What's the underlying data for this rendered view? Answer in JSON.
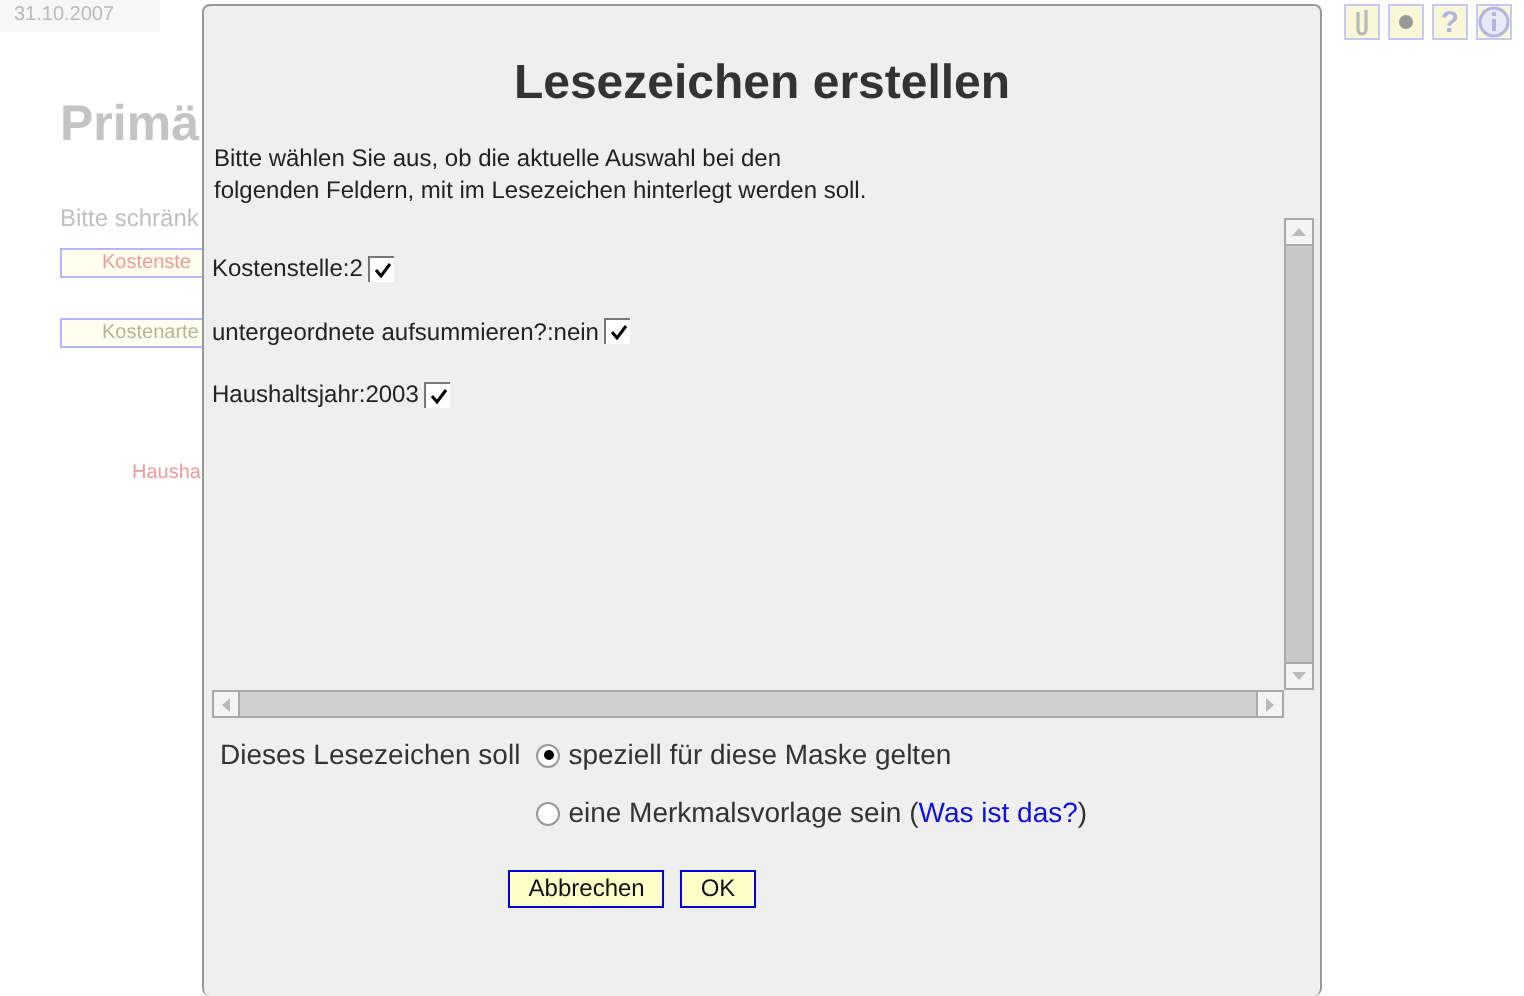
{
  "background": {
    "date": "31.10.2007",
    "title": "Primä",
    "prompt": "Bitte schränk",
    "fields": [
      {
        "label": "Kostenste",
        "color": "#f09a9a"
      },
      {
        "label": "Kostenarte",
        "color": "#b4b49c"
      }
    ],
    "note": {
      "label": "Hausha",
      "color": "#f09a9a"
    }
  },
  "toolbar": [
    {
      "kind": "attach"
    },
    {
      "kind": "dot"
    },
    {
      "kind": "help",
      "glyph": "?"
    },
    {
      "kind": "info"
    }
  ],
  "dialog": {
    "title": "Lesezeichen erstellen",
    "description": [
      "Bitte wählen Sie aus, ob die aktuelle Auswahl bei den",
      "folgenden Feldern, mit im Lesezeichen hinterlegt werden soll."
    ],
    "items": [
      {
        "label": "Kostenstelle:2",
        "checked": true
      },
      {
        "label": "untergeordnete aufsummieren?:nein",
        "checked": true
      },
      {
        "label": "Haushaltsjahr:2003",
        "checked": true
      }
    ],
    "scope": {
      "label": "Dieses Lesezeichen soll",
      "options": [
        {
          "text": "speziell für diese Maske gelten",
          "selected": true
        },
        {
          "text": "eine Merkmalsvorlage sein (",
          "link": "Was ist das?",
          "text_after": ")",
          "selected": false
        }
      ]
    },
    "buttons": [
      "Abbrechen",
      "OK"
    ]
  }
}
